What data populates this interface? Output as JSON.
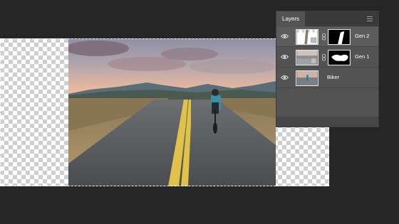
{
  "layers_panel": {
    "tab_label": "Layers",
    "menu_icon": "hamburger-menu-icon",
    "layers": [
      {
        "name": "Gen 2",
        "visibility_icon": "eye-icon",
        "visible": true,
        "has_mask": true
      },
      {
        "name": "Gen 1",
        "visibility_icon": "eye-icon",
        "visible": true,
        "has_mask": true
      },
      {
        "name": "Biker",
        "visibility_icon": "eye-icon",
        "visible": true,
        "has_mask": false
      }
    ]
  },
  "colors": {
    "app_background": "#262626",
    "panel_background": "#535353",
    "panel_header": "#3a3a3a",
    "selection_border": "#ffffff"
  }
}
